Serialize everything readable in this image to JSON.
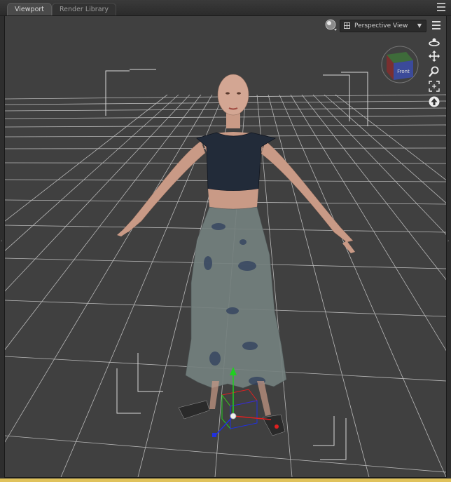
{
  "tabs": [
    {
      "label": "Viewport",
      "active": true
    },
    {
      "label": "Render Library",
      "active": false
    }
  ],
  "viewport": {
    "view_mode": "Perspective View",
    "cube_face_label": "Front"
  },
  "icons": {
    "tab_menu": "panel-menu-icon",
    "draw_style": "sphere-draw-style-icon",
    "view_menu": "options-menu-icon",
    "orbit": "orbit-icon",
    "pan": "pan-move-icon",
    "zoom": "zoom-magnifier-icon",
    "frame": "frame-selection-icon",
    "up": "reset-up-arrow-icon"
  },
  "colors": {
    "viewport_bg": "#404040",
    "grid_line": "#bdbdbd",
    "accent_bar": "#e0c25b",
    "gizmo_x": "#e02020",
    "gizmo_y": "#20d020",
    "gizmo_z": "#2030e0"
  }
}
